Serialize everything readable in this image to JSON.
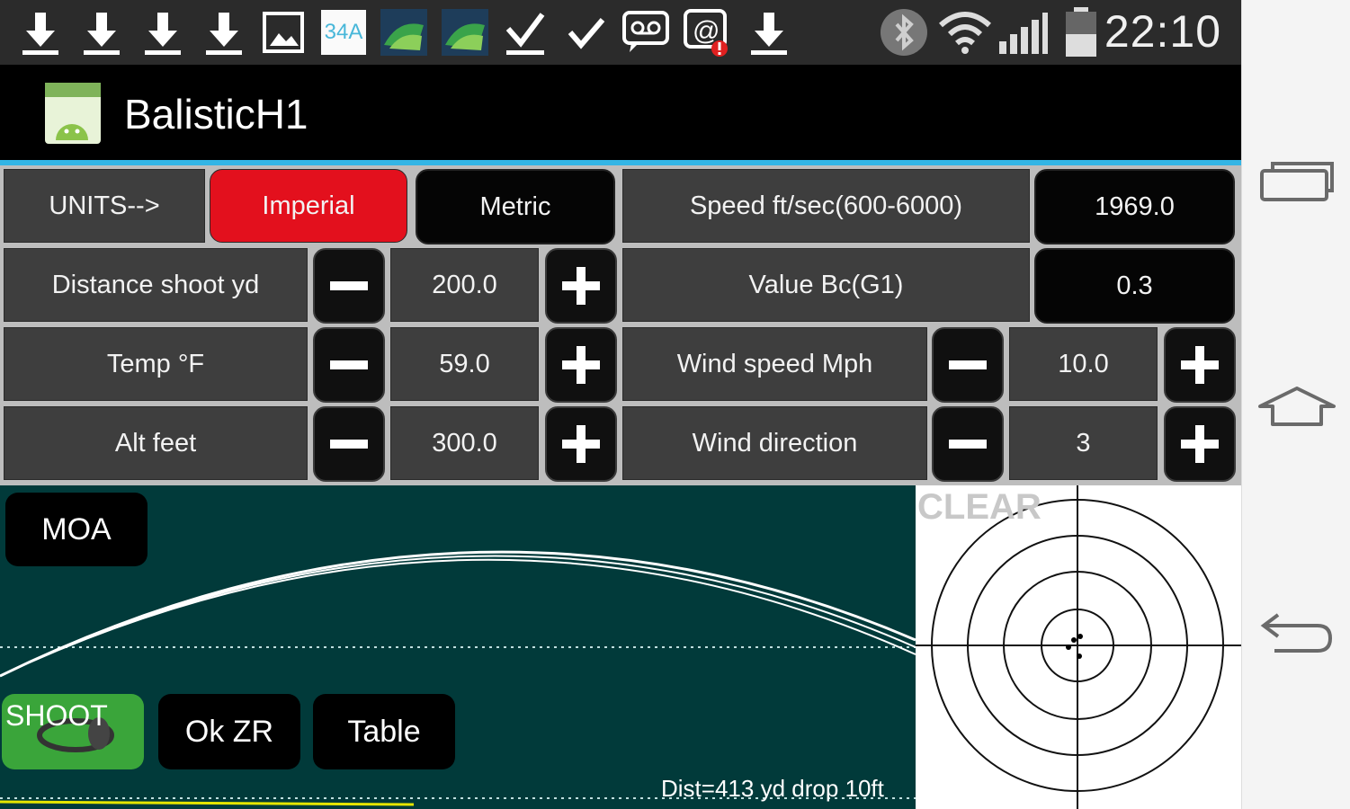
{
  "status_bar": {
    "time": "22:10",
    "notification_icons": [
      "download-icon",
      "download-icon",
      "download-icon",
      "download-icon",
      "image-icon",
      "app-34a-icon",
      "gis-app-icon",
      "gis-app-icon",
      "checkmark-underline-icon",
      "checkmark-icon",
      "voicemail-icon",
      "email-alert-icon",
      "download-icon"
    ],
    "app_icon_label": "34A",
    "system_icons": [
      "bluetooth-icon",
      "wifi-icon",
      "signal-icon",
      "battery-icon"
    ]
  },
  "action_bar": {
    "title": "BalisticH1"
  },
  "controls": {
    "units_label": "UNITS-->",
    "imperial_label": "Imperial",
    "metric_label": "Metric",
    "speed_label": "Speed ft/sec(600-6000)",
    "speed_value": "1969.0",
    "distance_label": "Distance shoot yd",
    "distance_value": "200.0",
    "bc_label": "Value Bc(G1)",
    "bc_value": "0.3",
    "temp_label": "Temp °F",
    "temp_value": "59.0",
    "wind_speed_label": "Wind speed Mph",
    "wind_speed_value": "10.0",
    "alt_label": "Alt feet",
    "alt_value": "300.0",
    "wind_dir_label": "Wind direction",
    "wind_dir_value": "3"
  },
  "plot": {
    "moa_label": "MOA",
    "shoot_label": "SHOOT",
    "okzr_label": "Ok ZR",
    "table_label": "Table",
    "info_text": "Dist=413 yd drop 10ft",
    "background_color": "#013a3a"
  },
  "target": {
    "clear_label": "CLEAR"
  },
  "colors": {
    "accent": "#33b5e5",
    "active_unit": "#e3101d"
  }
}
